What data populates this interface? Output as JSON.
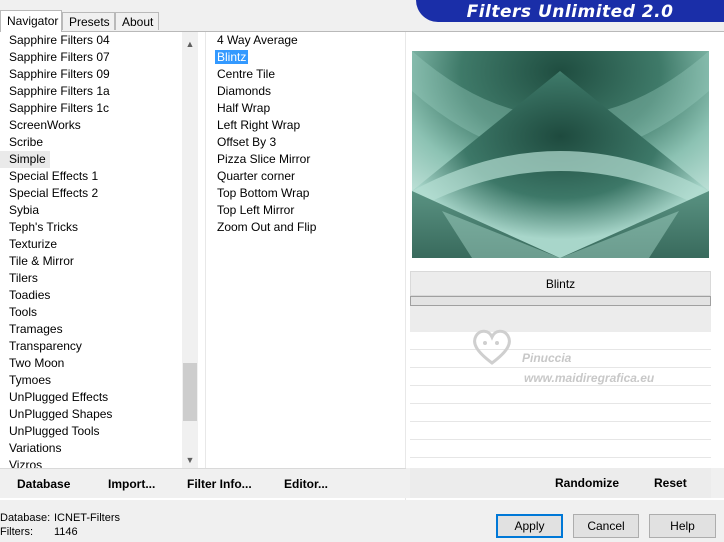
{
  "tabs": [
    {
      "label": "Navigator"
    },
    {
      "label": "Presets"
    },
    {
      "label": "About"
    }
  ],
  "banner_title": "Filters Unlimited 2.0",
  "categories": [
    {
      "label": "Sapphire Filters 04"
    },
    {
      "label": "Sapphire Filters 07"
    },
    {
      "label": "Sapphire Filters 09"
    },
    {
      "label": "Sapphire Filters 1a"
    },
    {
      "label": "Sapphire Filters 1c"
    },
    {
      "label": "ScreenWorks"
    },
    {
      "label": "Scribe"
    },
    {
      "label": "Simple"
    },
    {
      "label": "Special Effects 1"
    },
    {
      "label": "Special Effects 2"
    },
    {
      "label": "Sybia"
    },
    {
      "label": "Teph's Tricks"
    },
    {
      "label": "Texturize"
    },
    {
      "label": "Tile & Mirror"
    },
    {
      "label": "Tilers"
    },
    {
      "label": "Toadies"
    },
    {
      "label": "Tools"
    },
    {
      "label": "Tramages"
    },
    {
      "label": "Transparency"
    },
    {
      "label": "Two Moon"
    },
    {
      "label": "Tymoes"
    },
    {
      "label": "UnPlugged Effects"
    },
    {
      "label": "UnPlugged Shapes"
    },
    {
      "label": "UnPlugged Tools"
    },
    {
      "label": "Variations"
    },
    {
      "label": "Vizros"
    }
  ],
  "selected_category": "Simple",
  "filters": [
    {
      "label": "4 Way Average"
    },
    {
      "label": "Blintz"
    },
    {
      "label": "Centre Tile"
    },
    {
      "label": "Diamonds"
    },
    {
      "label": "Half Wrap"
    },
    {
      "label": "Left Right Wrap"
    },
    {
      "label": "Offset By 3"
    },
    {
      "label": "Pizza Slice Mirror"
    },
    {
      "label": "Quarter corner"
    },
    {
      "label": "Top Bottom Wrap"
    },
    {
      "label": "Top Left Mirror"
    },
    {
      "label": "Zoom Out and Flip"
    }
  ],
  "selected_filter": "Blintz",
  "param_title": "Blintz",
  "watermark": {
    "name": "Pinuccia",
    "site": "www.maidiregrafica.eu"
  },
  "actions": {
    "database": "Database",
    "import": "Import...",
    "filter_info": "Filter Info...",
    "editor": "Editor...",
    "randomize": "Randomize",
    "reset": "Reset"
  },
  "status": {
    "database_label": "Database:",
    "database_value": "ICNET-Filters",
    "filters_label": "Filters:",
    "filters_value": "1146"
  },
  "buttons": {
    "apply": "Apply",
    "cancel": "Cancel",
    "help": "Help"
  },
  "colors": {
    "banner": "#1a2ea8",
    "selection": "#3399ff",
    "preview_dark": "#2c5e50",
    "preview_light": "#a6d4c8"
  }
}
